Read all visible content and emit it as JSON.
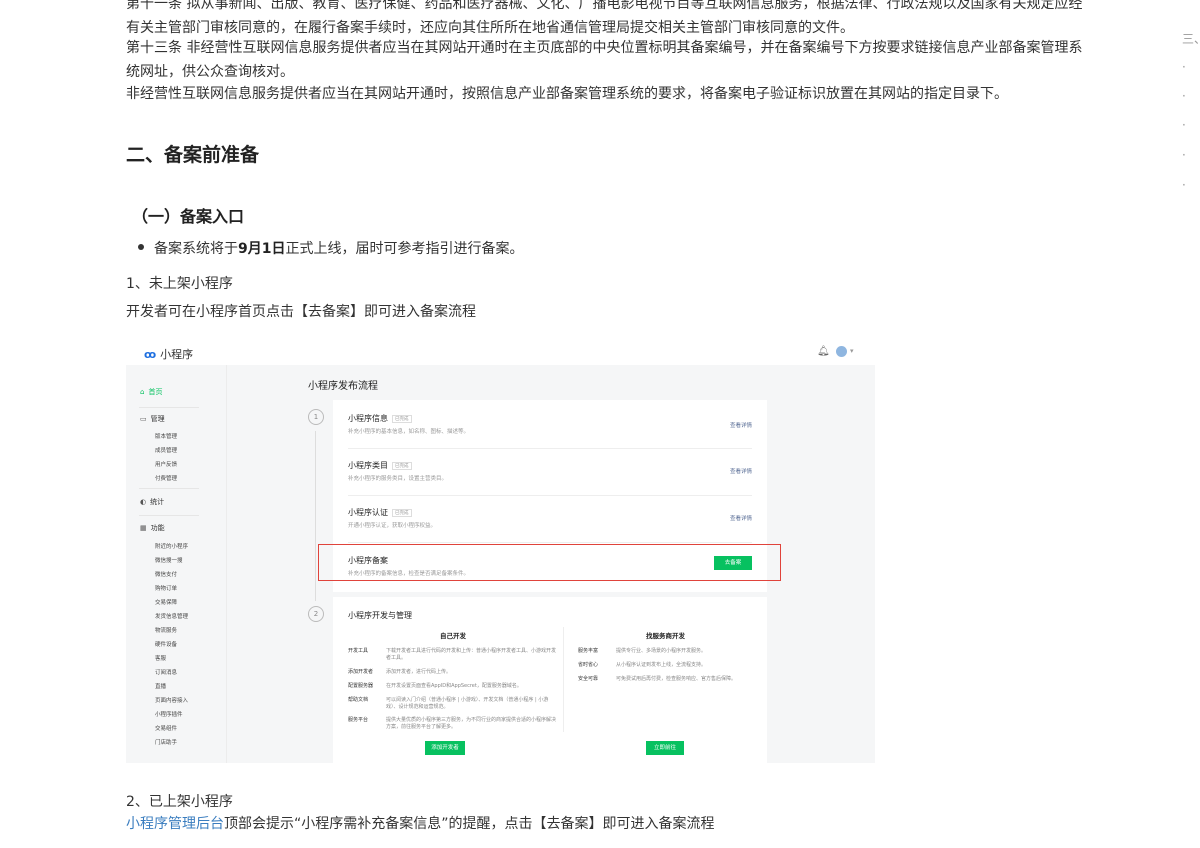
{
  "article": {
    "p1": "第十一条 拟从事新闻、出版、教育、医疗保健、药品和医疗器械、文化、广播电影电视节目等互联网信息服务，根据法律、行政法规以及国家有关规定应经有关主管部门审核同意的，在履行备案手续时，还应向其住所所在地省通信管理局提交相关主管部门审核同意的文件。",
    "p2": "第十三条 非经营性互联网信息服务提供者应当在其网站开通时在主页底部的中央位置标明其备案编号，并在备案编号下方按要求链接信息产业部备案管理系统网址，供公众查询核对。",
    "p3": "非经营性互联网信息服务提供者应当在其网站开通时，按照信息产业部备案管理系统的要求，将备案电子验证标识放置在其网站的指定目录下。",
    "h2": "二、备案前准备",
    "h3": "（一）备案入口",
    "bullet_prefix": "备案系统将于",
    "bullet_bold": "9月1日",
    "bullet_suffix": "正式上线，届时可参考指引进行备案。",
    "step1_title": "1、未上架小程序",
    "step1_desc": "开发者可在小程序首页点击【去备案】即可进入备案流程",
    "step2_title": "2、已上架小程序",
    "step2_link": "小程序管理后台",
    "step2_desc": "顶部会提示“小程序需补充备案信息”的提醒，点击【去备案】即可进入备案流程"
  },
  "toc": {
    "items": [
      "三、",
      "·",
      "·",
      "·",
      "·",
      "·",
      "·"
    ]
  },
  "screenshot": {
    "app_name": "小程序",
    "page_title": "小程序发布流程",
    "sidebar": {
      "home": "首页",
      "manage": "管理",
      "manage_items": [
        "版本管理",
        "成员管理",
        "用户反馈",
        "付费管理"
      ],
      "stats": "统计",
      "features": "功能",
      "feature_items": [
        "附近的小程序",
        "微信搜一搜",
        "微信支付",
        "购物订单",
        "交易保障",
        "发货信息管理",
        "物流服务",
        "硬件设备",
        "客服",
        "订阅消息",
        "直播",
        "页面内容接入",
        "小程序插件",
        "交易组件",
        "门店助手"
      ]
    },
    "steps": [
      "1",
      "2"
    ],
    "rows": [
      {
        "title": "小程序信息",
        "tag": "已完成",
        "desc": "补充小程序的基本信息，如名称、图标、描述等。",
        "action": "查看详情"
      },
      {
        "title": "小程序类目",
        "tag": "已完成",
        "desc": "补充小程序的服务类目，设置主营类目。",
        "action": "查看详情"
      },
      {
        "title": "小程序认证",
        "tag": "已完成",
        "desc": "开通小程序认证，获取小程序权益。",
        "action": "查看详情"
      },
      {
        "title": "小程序备案",
        "tag": "",
        "desc": "补充小程序的备案信息，检查是否满足备案条件。",
        "action": "去备案"
      }
    ],
    "dev": {
      "title": "小程序开发与管理",
      "left_head": "自己开发",
      "left_items": [
        {
          "k": "开发工具",
          "v": "下载开发者工具进行代码的开发和上传：普通小程序开发者工具、小游戏开发者工具。"
        },
        {
          "k": "添加开发者",
          "v": "添加开发者，进行代码上传。"
        },
        {
          "k": "配置服务器",
          "v": "在开发设置页面查看AppID和AppSecret，配置服务器域名。"
        },
        {
          "k": "帮助文档",
          "v": "可以阅读入门介绍（普通小程序 | 小游戏）、开发文档（普通小程序 | 小游戏）、设计规范和运营规范。"
        },
        {
          "k": "服务平台",
          "v": "提供大量优质的小程序第三方服务，为不同行业的商家提供合适的小程序解决方案，前往服务平台了解更多。"
        }
      ],
      "left_btn": "添加开发者",
      "right_head": "找服务商开发",
      "right_items": [
        {
          "k": "服务丰富",
          "v": "提供专行业、多场景的小程序开发服务。"
        },
        {
          "k": "省时省心",
          "v": "从小程序认证到发布上线，全流程支持。"
        },
        {
          "k": "安全可靠",
          "v": "可免费试用后再付费，检查服务响应、官方售后保障。"
        }
      ],
      "right_btn": "立即前往"
    }
  }
}
